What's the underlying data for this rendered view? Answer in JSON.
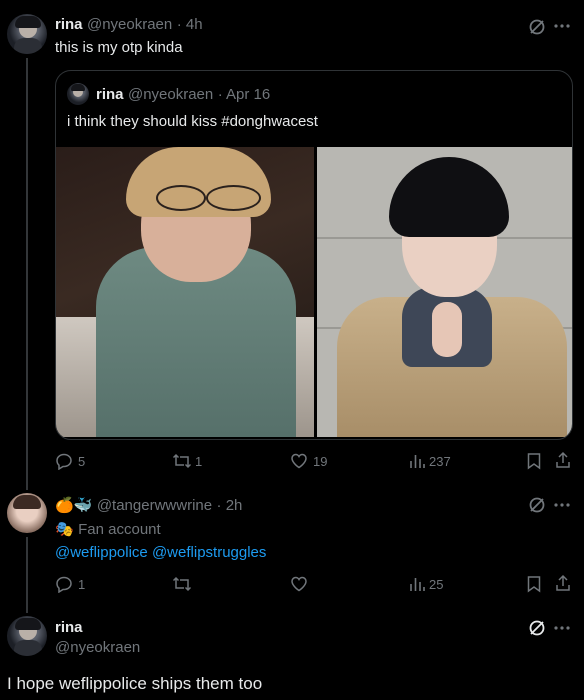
{
  "tweet1": {
    "name": "rina",
    "handle": "@nyeokraen",
    "time": "· 4h",
    "text": "this is my otp kinda",
    "quote": {
      "name": "rina",
      "handle": "@nyeokraen",
      "date": "· Apr 16",
      "text": "i think they should kiss #donghwacest"
    },
    "actions": {
      "replies": "5",
      "retweets": "1",
      "likes": "19",
      "views": "237"
    }
  },
  "tweet2": {
    "emoji_name": "🍊🐳",
    "handle": "@tangerwwwrine",
    "time": "· 2h",
    "label_icon": "🎭",
    "label": "Fan account",
    "mention1": "@weflippolice",
    "mention2": "@weflipstruggles",
    "actions": {
      "replies": "1",
      "retweets": "",
      "likes": "",
      "views": "25"
    }
  },
  "tweet3": {
    "name": "rina",
    "handle": "@nyeokraen",
    "text": "I hope weflippolice ships them too"
  },
  "colors": {
    "background": "#000000",
    "text": "#e7e9ea",
    "muted": "#71767b",
    "link": "#1d9bf0",
    "border": "#2f3336"
  }
}
